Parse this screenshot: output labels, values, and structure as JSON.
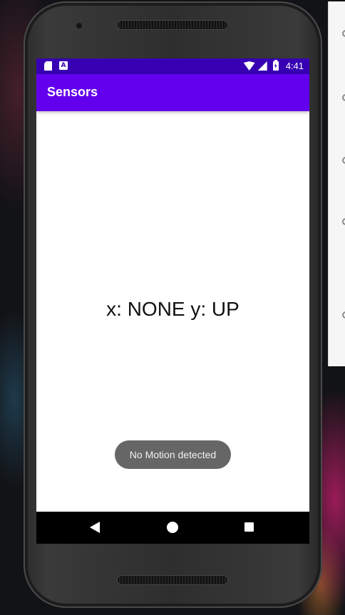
{
  "app": {
    "title": "Sensors"
  },
  "status_bar": {
    "time": "4:41",
    "notification_letter": "A",
    "icons": [
      "sd-card-icon",
      "a-notification-icon",
      "wifi-icon",
      "signal-icon",
      "battery-charging-icon"
    ]
  },
  "main": {
    "reading": "x: NONE y: UP"
  },
  "toast": {
    "message": "No Motion detected"
  },
  "nav_bar": {
    "buttons": [
      "back-icon",
      "home-icon",
      "recents-icon"
    ]
  },
  "colors": {
    "status_bar": "#3700b3",
    "app_bar": "#6200ee",
    "toast": "#666666",
    "nav_bar": "#000000"
  }
}
